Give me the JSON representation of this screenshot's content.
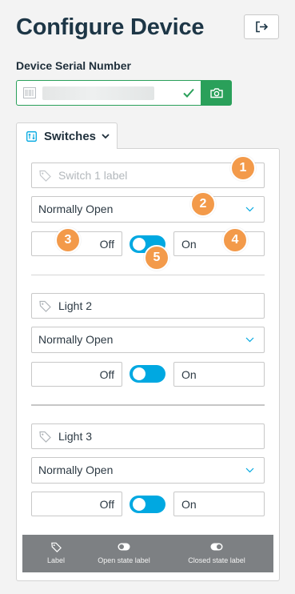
{
  "header": {
    "title": "Configure Device"
  },
  "serial": {
    "label": "Device Serial Number",
    "value": ""
  },
  "tab": {
    "label": "Switches"
  },
  "switches": [
    {
      "label_placeholder": "Switch 1 label",
      "label_value": "",
      "select": "Normally Open",
      "off": "Off",
      "on": "On",
      "toggle_on": true
    },
    {
      "label_placeholder": "",
      "label_value": "Light 2",
      "select": "Normally Open",
      "off": "Off",
      "on": "On",
      "toggle_on": true
    },
    {
      "label_placeholder": "",
      "label_value": "Light 3",
      "select": "Normally Open",
      "off": "Off",
      "on": "On",
      "toggle_on": true
    }
  ],
  "markers": [
    "1",
    "2",
    "3",
    "4",
    "5"
  ],
  "legend": [
    {
      "icon": "tag-icon",
      "label": "Label"
    },
    {
      "icon": "toggle-off-icon",
      "label": "Open state label"
    },
    {
      "icon": "toggle-on-icon",
      "label": "Closed state label"
    }
  ],
  "colors": {
    "accent_green": "#2aa05a",
    "toggle_blue": "#00a8e1",
    "marker_orange": "#f39a4a",
    "title": "#1d3646"
  }
}
